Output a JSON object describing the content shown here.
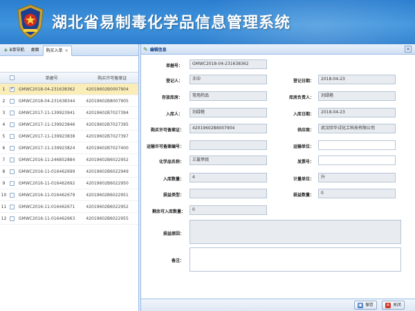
{
  "app": {
    "title": "湖北省易制毒化学品信息管理系统"
  },
  "tabs": [
    {
      "label": "ⅲ单导航"
    },
    {
      "label": "桌面"
    },
    {
      "label": "购买入单",
      "close": "×"
    }
  ],
  "grid": {
    "headers": {
      "no": "单据号",
      "license": "购买许可备案证"
    },
    "rows": [
      {
        "num": "1",
        "checked": true,
        "no": "GMWC2018-04-231638362",
        "license": "42019602B0007904"
      },
      {
        "num": "2",
        "checked": false,
        "no": "GMWC2018-04-231638344",
        "license": "42019602B8007905"
      },
      {
        "num": "3",
        "checked": false,
        "no": "GMWC2017-11-139923941",
        "license": "42019602B7027394"
      },
      {
        "num": "4",
        "checked": false,
        "no": "GMWC2017-11-139923846",
        "license": "42019602B7027395"
      },
      {
        "num": "5",
        "checked": false,
        "no": "GMWC2017-11-139923838",
        "license": "42019602B7027397"
      },
      {
        "num": "6",
        "checked": false,
        "no": "GMWC2017-11-139923824",
        "license": "42019602B7027400"
      },
      {
        "num": "7",
        "checked": false,
        "no": "GMWC2016-11-246852884",
        "license": "42019602B6022952"
      },
      {
        "num": "8",
        "checked": false,
        "no": "GMWC2016-11-016462699",
        "license": "42019602B6022949"
      },
      {
        "num": "9",
        "checked": false,
        "no": "GMWC2016-11-016462692",
        "license": "42019602B6022950"
      },
      {
        "num": "10",
        "checked": false,
        "no": "GMWC2016-11-016462679",
        "license": "42019602B6022951"
      },
      {
        "num": "11",
        "checked": false,
        "no": "GMWC2016-11-016462671",
        "license": "42019602B6022952"
      },
      {
        "num": "12",
        "checked": false,
        "no": "GMWC2016-11-016462663",
        "license": "42019602B6022955"
      }
    ]
  },
  "panel": {
    "title": "编辑信息",
    "close": "×"
  },
  "form": {
    "doc_no": {
      "label": "单据号：",
      "value": "GMWC2018-04-231638362"
    },
    "registrar": {
      "label": "登记人：",
      "value": "王中"
    },
    "reg_date": {
      "label": "登记日期：",
      "value": "2018-04-23"
    },
    "warehouse": {
      "label": "存放库房：",
      "value": "常用药品"
    },
    "keeper": {
      "label": "库房负责人：",
      "value": "刘绿艳"
    },
    "inbound_person": {
      "label": "入库人：",
      "value": "刘绿艳"
    },
    "inbound_date": {
      "label": "入库日期：",
      "value": "2018-04-23"
    },
    "purchase_license": {
      "label": "购买许可备案证：",
      "value": "42019602B8007904"
    },
    "supplier": {
      "label": "供应商：",
      "value": "武汉欣华试化工科技有限公司"
    },
    "transport_license": {
      "label": "运输许可备案编号：",
      "value": ""
    },
    "transport_unit": {
      "label": "运输单位：",
      "value": ""
    },
    "chem_name": {
      "label": "化学品名称：",
      "value": "三氯甲烷"
    },
    "invoice_no": {
      "label": "发票号：",
      "value": ""
    },
    "inbound_qty": {
      "label": "入库数量：",
      "value": "4"
    },
    "unit": {
      "label": "计量单位：",
      "value": "升"
    },
    "loss_type": {
      "label": "损益类型：",
      "value": ""
    },
    "loss_qty": {
      "label": "损益数量：",
      "value": "0"
    },
    "remaining_qty": {
      "label": "剩余可入库数量：",
      "value": "0"
    },
    "loss_reason": {
      "label": "损益原因：",
      "value": ""
    },
    "remark": {
      "label": "备注：",
      "value": ""
    }
  },
  "buttons": {
    "save": "保存",
    "close": "关闭"
  },
  "colors": {
    "banner": "#3f94dd",
    "selected_row": "#fbedb8",
    "panel_border": "#99bbe8"
  }
}
